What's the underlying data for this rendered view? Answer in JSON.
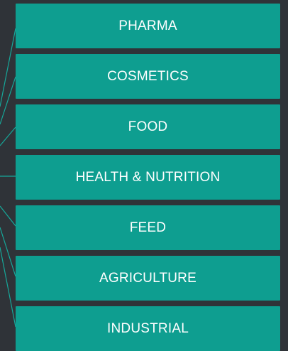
{
  "menu": {
    "items": [
      {
        "label": "PHARMA"
      },
      {
        "label": "COSMETICS"
      },
      {
        "label": "FOOD"
      },
      {
        "label": "HEALTH & NUTRITION"
      },
      {
        "label": "FEED"
      },
      {
        "label": "AGRICULTURE"
      },
      {
        "label": "INDUSTRIAL"
      }
    ]
  },
  "colors": {
    "background": "#2f3338",
    "item_background": "#0e9e90",
    "connector": "#16a89a",
    "text": "#ffffff"
  }
}
